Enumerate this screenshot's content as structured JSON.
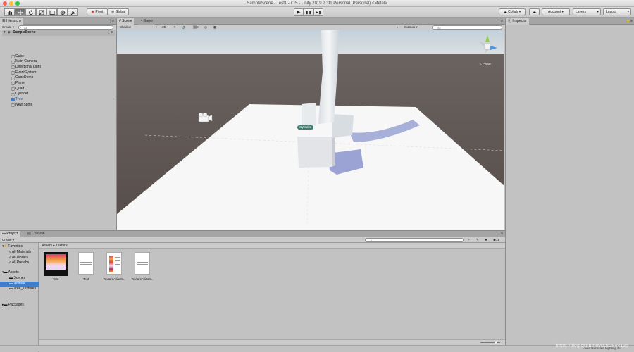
{
  "window": {
    "title": "SampleScene - Test1 - iOS - Unity 2019.2.3f1 Personal (Personal) <Metal>"
  },
  "toolbar": {
    "pivot_label": "Pivot",
    "global_label": "Global",
    "collab_label": "Collab ▾",
    "account_label": "Account ▾",
    "layers_label": "Layers",
    "layout_label": "Layout"
  },
  "hierarchy": {
    "tab_label": "Hierarchy",
    "create_label": "Create ▾",
    "search_placeholder": "All",
    "scene_name": "SampleScene",
    "items": [
      {
        "label": "Cube"
      },
      {
        "label": "Main Camera"
      },
      {
        "label": "Directional Light"
      },
      {
        "label": "EventSystem"
      },
      {
        "label": "CubeDemo"
      },
      {
        "label": "Plane"
      },
      {
        "label": "Quad"
      },
      {
        "label": "Cylinder"
      },
      {
        "label": "Tree"
      },
      {
        "label": "New Sprite"
      }
    ]
  },
  "scene": {
    "tabs": [
      "Scene",
      "Game"
    ],
    "shading_mode": "Shaded",
    "dimension_toggle": "2D",
    "gizmos_label": "Gizmos ▾",
    "search_placeholder": "All",
    "persp_label": "< Persp",
    "selected_object_label": "Cylinder"
  },
  "inspector": {
    "tab_label": "Inspector"
  },
  "project": {
    "tabs": [
      "Project",
      "Console"
    ],
    "create_label": "Create ▾",
    "breadcrumb": [
      "Assets",
      "Texture"
    ],
    "favorites_label": "Favorites",
    "favorites": [
      "All Materials",
      "All Models",
      "All Prefabs"
    ],
    "assets_label": "Assets",
    "asset_folders": [
      "Scenes",
      "Texture",
      "Tree_Textures"
    ],
    "packages_label": "Packages",
    "assets": [
      {
        "label": "Test"
      },
      {
        "label": "Test"
      },
      {
        "label": "TextureAtlasIt..."
      },
      {
        "label": "TextureAtlasIt..."
      }
    ]
  },
  "statusbar": {
    "lighting_text": "Auto Generate Lighting On",
    "watermark": "https://blog.csdn.net/u012844135"
  },
  "colors": {
    "panel": "#c2c2c2",
    "sky": "#c9d4dc",
    "ground": "#5d5450",
    "selection": "#3e7ecb"
  }
}
